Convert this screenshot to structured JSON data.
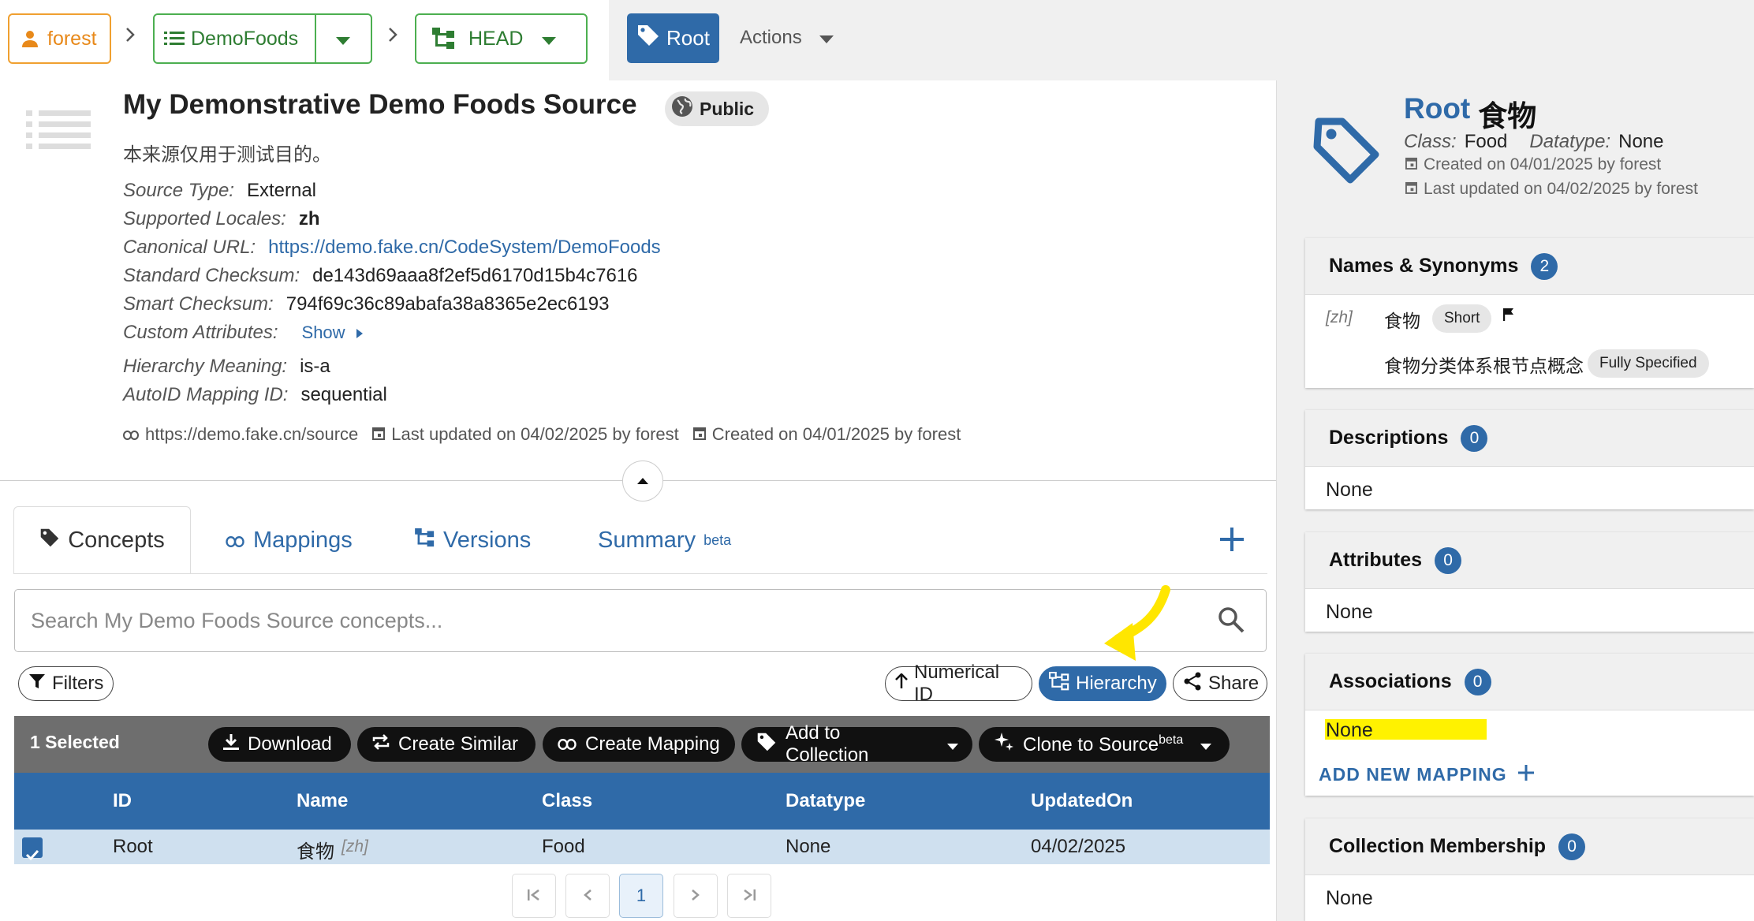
{
  "breadcrumb": {
    "owner": "forest",
    "repo": "DemoFoods",
    "version": "HEAD",
    "sep": ">"
  },
  "toolbar": {
    "root_label": "Root",
    "actions_label": "Actions"
  },
  "source": {
    "title": "My Demonstrative Demo Foods Source",
    "visibility": "Public",
    "description": "本来源仅用于测试目的。",
    "props": [
      {
        "key": "Source Type:",
        "value": "External"
      },
      {
        "key": "Supported Locales:",
        "value": "zh"
      },
      {
        "key": "Canonical URL:",
        "value": "https://demo.fake.cn/CodeSystem/DemoFoods"
      },
      {
        "key": "Standard Checksum:",
        "value": "de143d69aaa8f2ef5d6170d15b4c7616"
      },
      {
        "key": "Smart Checksum:",
        "value": "794f69c36c89abafa38a8365e2ec6193"
      },
      {
        "key": "Custom Attributes:",
        "value": "Show"
      },
      {
        "key": "Hierarchy Meaning:",
        "value": "is-a"
      },
      {
        "key": "AutoID Mapping ID:",
        "value": "sequential"
      }
    ],
    "url": "https://demo.fake.cn/source",
    "updated": "Last updated on 04/02/2025 by forest",
    "created": "Created on 04/01/2025 by forest"
  },
  "tabs": [
    {
      "label": "Concepts",
      "sup": ""
    },
    {
      "label": "Mappings",
      "sup": ""
    },
    {
      "label": "Versions",
      "sup": ""
    },
    {
      "label": "Summary",
      "sup": "beta"
    }
  ],
  "search": {
    "placeholder": "Search My Demo Foods Source concepts..."
  },
  "filters": {
    "filters_label": "Filters",
    "numerical_label": "Numerical ID",
    "hierarchy_label": "Hierarchy",
    "share_label": "Share"
  },
  "selection": {
    "count_label": "1 Selected",
    "download": "Download",
    "create_similar": "Create Similar",
    "create_mapping": "Create Mapping",
    "add_to_collection": "Add to Collection",
    "clone": "Clone to Source",
    "clone_sup": "beta"
  },
  "table": {
    "columns": [
      "ID",
      "Name",
      "Class",
      "Datatype",
      "UpdatedOn"
    ],
    "rows": [
      {
        "id": "Root",
        "name": "食物",
        "locale": "[zh]",
        "class": "Food",
        "datatype": "None",
        "updated": "04/02/2025"
      }
    ]
  },
  "pagination": {
    "current": "1"
  },
  "concept": {
    "id": "Root",
    "name": "食物",
    "class_key": "Class:",
    "class_val": "Food",
    "datatype_key": "Datatype:",
    "datatype_val": "None",
    "created": "Created on 04/01/2025 by forest",
    "updated": "Last updated on 04/02/2025 by forest"
  },
  "names_card": {
    "title": "Names & Synonyms",
    "count": "2",
    "locale": "[zh]",
    "names": [
      {
        "name": "食物",
        "type": "Short"
      },
      {
        "name": "食物分类体系根节点概念",
        "type": "Fully Specified"
      }
    ]
  },
  "descriptions_card": {
    "title": "Descriptions",
    "count": "0",
    "empty": "None"
  },
  "attributes_card": {
    "title": "Attributes",
    "count": "0",
    "empty": "None"
  },
  "associations_card": {
    "title": "Associations",
    "count": "0",
    "empty": "None",
    "add_label": "ADD NEW MAPPING"
  },
  "collection_card": {
    "title": "Collection Membership",
    "count": "0",
    "empty": "None"
  },
  "colors": {
    "primary": "#2f6aa8",
    "owner": "#e8891a",
    "repo": "#2e7d32",
    "annotation": "#fff200"
  }
}
